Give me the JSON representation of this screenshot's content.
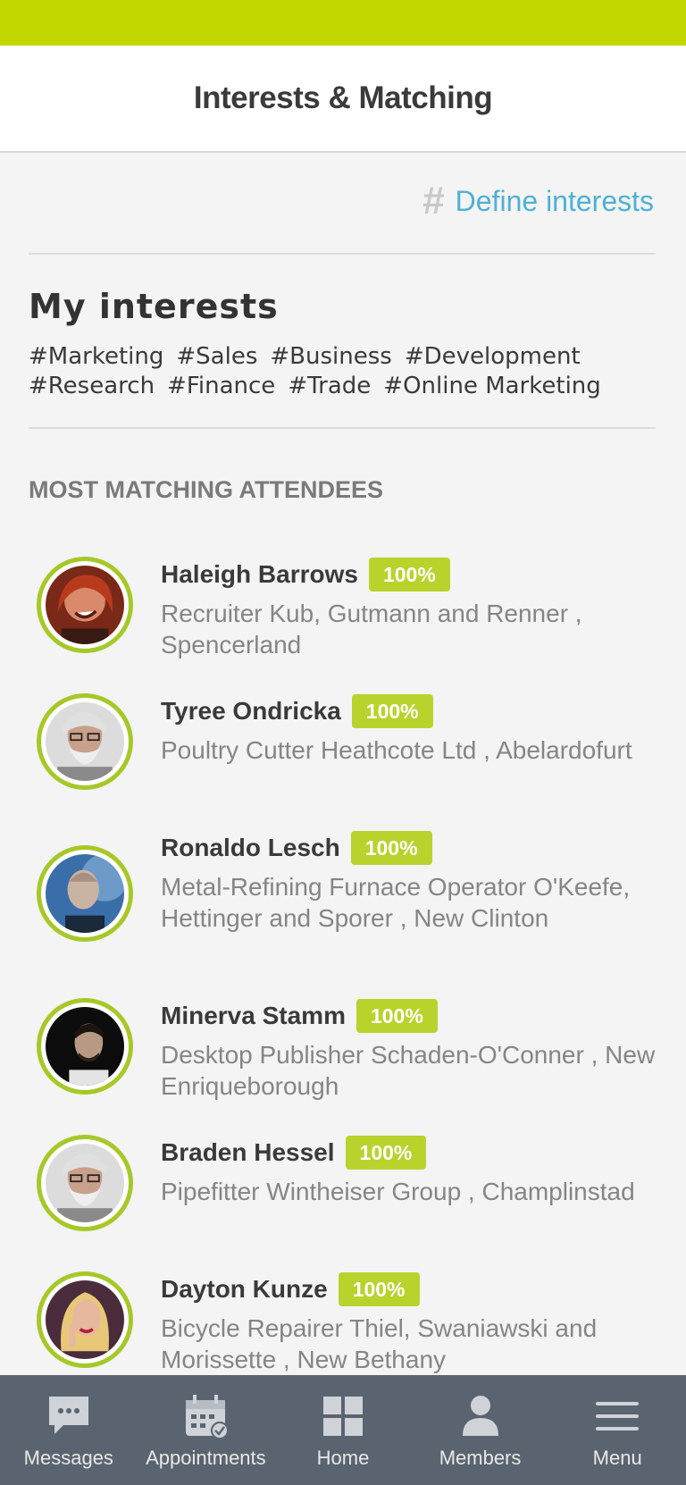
{
  "header": {
    "title": "Interests & Matching"
  },
  "define": {
    "hash": "#",
    "label": "Define interests"
  },
  "my_interests": {
    "title": "My interests",
    "tags": [
      "#Marketing",
      "#Sales",
      "#Business",
      "#Development",
      "#Research",
      "#Finance",
      "#Trade",
      "#Online Marketing"
    ]
  },
  "matching": {
    "title": "MOST MATCHING ATTENDEES",
    "attendees": [
      {
        "name": "Haleigh Barrows",
        "match": "100%",
        "role": "Recruiter Kub, Gutmann and Renner , Spencerland"
      },
      {
        "name": "Tyree Ondricka",
        "match": "100%",
        "role": "Poultry Cutter Heathcote Ltd , Abelardofurt"
      },
      {
        "name": "Ronaldo Lesch",
        "match": "100%",
        "role": "Metal-Refining Furnace Operator O'Keefe, Hettinger and Sporer , New Clinton"
      },
      {
        "name": "Minerva Stamm",
        "match": "100%",
        "role": "Desktop Publisher Schaden-O'Conner , New Enriqueborough"
      },
      {
        "name": "Braden Hessel",
        "match": "100%",
        "role": "Pipefitter Wintheiser Group , Champlinstad"
      },
      {
        "name": "Dayton Kunze",
        "match": "100%",
        "role": "Bicycle Repairer Thiel, Swaniawski and Morissette , New Bethany"
      }
    ]
  },
  "tabs": [
    {
      "label": "Messages",
      "icon": "chat-bubble-icon"
    },
    {
      "label": "Appointments",
      "icon": "calendar-check-icon"
    },
    {
      "label": "Home",
      "icon": "grid-icon"
    },
    {
      "label": "Members",
      "icon": "person-icon"
    },
    {
      "label": "Menu",
      "icon": "hamburger-icon"
    }
  ],
  "colors": {
    "accent": "#c2d700",
    "badge": "#b9d32c",
    "link": "#4fb0d3",
    "tab_bar": "#5a6470"
  }
}
